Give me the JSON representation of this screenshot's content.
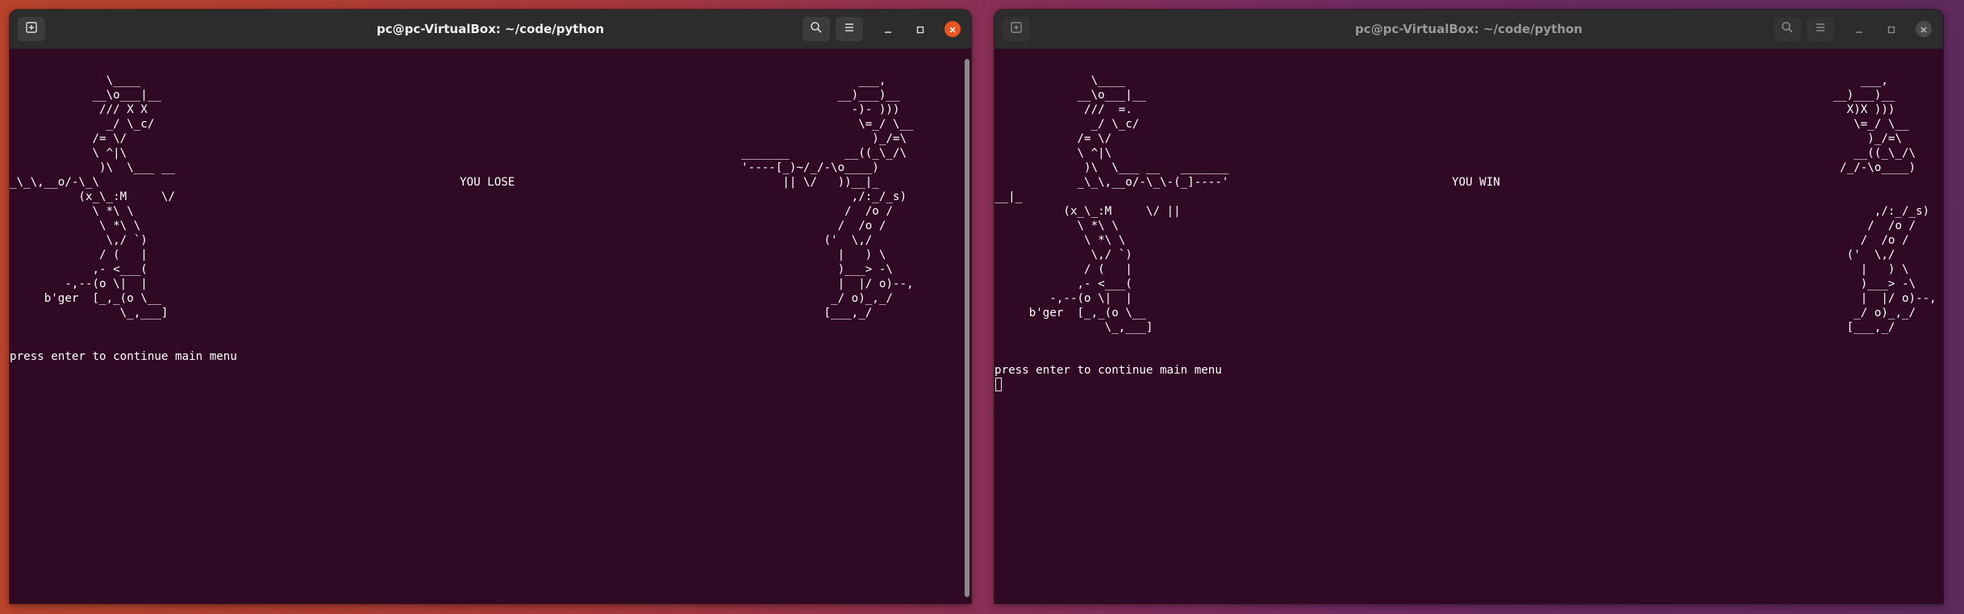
{
  "left_window": {
    "title": "pc@pc-VirtualBox: ~/code/python",
    "terminal": {
      "player_art": "              \\____\n            __\\o___|__\n             /// X X\n              _/ \\_c/\n            /= \\/\n            \\ ^|\\\n             )\\  \\___ __\n_\\_\\,__o/-\\_\\\n          (x_\\_:M     \\/\n            \\ *\\ \\\n             \\ *\\ \\\n              \\,/ `)\n             / (   |\n            ,- <___(\n        -,--(o \\|  |\n     b'ger  [_,_(o \\__\n                \\_,___]",
      "status": "YOU LOSE",
      "enemy_art": "                 ___,\n              __)___)__\n                -)- )))\n                 \\=_/ \\__\n                   )_/=\\\n_______        __((_\\_/\\\n'----[_)~/_/-\\o____)\n      || \\/   ))__|_\n                ,/:_/_s)\n               /  /o /\n              /  /o /\n            ('  \\,/\n              |   ) \\\n              )___> -\\\n              |  |/ o)--,\n             _/ o)_,_/\n            [___,_/",
      "prompt": "press enter to continue main menu"
    }
  },
  "right_window": {
    "title": "pc@pc-VirtualBox: ~/code/python",
    "terminal": {
      "player_art": "              \\____\n            __\\o___|__\n             ///  =.\n              _/ \\_c/\n            /= \\/\n            \\ ^|\\\n             )\\  \\___ __   _______\n            _\\_\\,__o/-\\_\\-(_]----'\n__|_\n          (x_\\_:M     \\/ ||\n            \\ *\\ \\\n             \\ *\\ \\\n              \\,/ `)\n             / (   |\n            ,- <___(\n        -,--(o \\|  |\n     b'ger  [_,_(o \\__\n                \\_,___]",
      "status": "YOU WIN",
      "enemy_art": "                  ___,\n              __)___)__\n                X)X )))\n                 \\=_/ \\__\n                   )_/=\\\n                 __((_\\_/\\\n               /_/-\\o____)\n                              \\/   ))\n\n                    ,/:_/_s)\n                   /  /o /\n                  /  /o /\n                ('  \\,/\n                  |   ) \\\n                  )___> -\\\n                  |  |/ o)--,\n                 _/ o)_,_/\n                [___,_/",
      "prompt": "press enter to continue main menu"
    }
  },
  "icons": [
    "new-tab-icon",
    "search-icon",
    "hamburger-menu-icon",
    "minimize-icon",
    "maximize-icon",
    "close-icon"
  ],
  "colors": {
    "terminal_bg": "#300a24",
    "titlebar_bg": "#2c2c2c",
    "close_active": "#e95420",
    "text": "#ffffff"
  }
}
